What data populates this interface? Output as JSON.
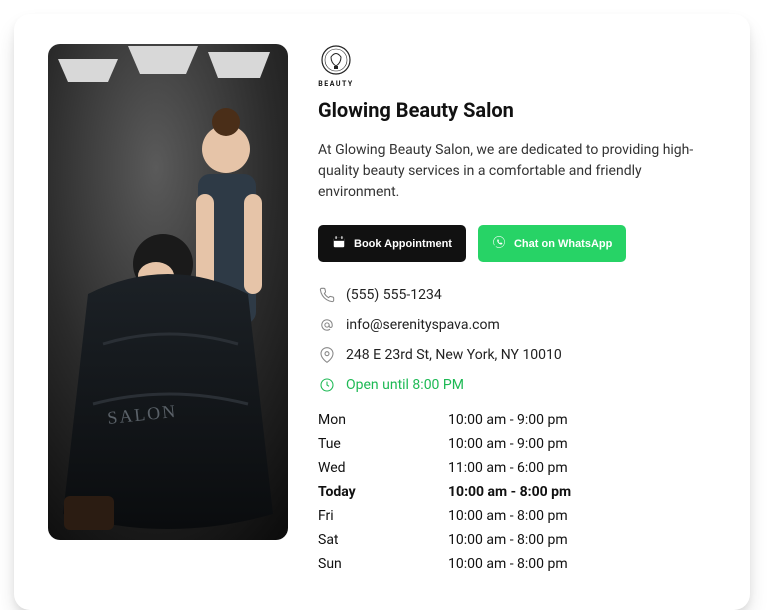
{
  "logo_text": "BEAUTY",
  "title": "Glowing Beauty Salon",
  "description": "At Glowing Beauty Salon, we are dedicated to providing high-quality beauty services in a comfortable and friendly environment.",
  "buttons": {
    "book": "Book Appointment",
    "whatsapp": "Chat on WhatsApp"
  },
  "contact": {
    "phone": "(555) 555-1234",
    "email": "info@serenityspava.com",
    "address": "248 E 23rd St, New York, NY 10010",
    "status": "Open until 8:00 PM"
  },
  "hours": [
    {
      "day": "Mon",
      "time": "10:00 am - 9:00 pm",
      "today": false
    },
    {
      "day": "Tue",
      "time": "10:00 am - 9:00 pm",
      "today": false
    },
    {
      "day": "Wed",
      "time": "11:00 am - 6:00 pm",
      "today": false
    },
    {
      "day": "Today",
      "time": "10:00 am - 8:00 pm",
      "today": true
    },
    {
      "day": "Fri",
      "time": "10:00 am - 8:00 pm",
      "today": false
    },
    {
      "day": "Sat",
      "time": "10:00 am - 8:00 pm",
      "today": false
    },
    {
      "day": "Sun",
      "time": "10:00 am - 8:00 pm",
      "today": false
    }
  ],
  "colors": {
    "green": "#27d366",
    "status": "#1db954",
    "dark": "#111111"
  }
}
